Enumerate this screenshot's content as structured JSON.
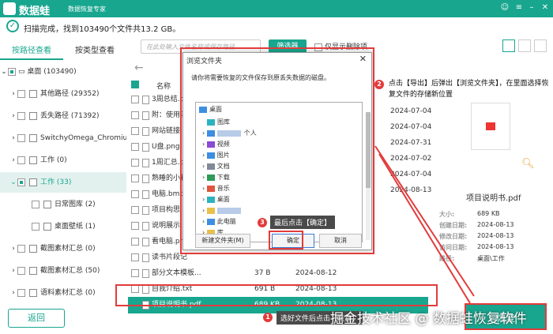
{
  "app": {
    "name": "数据蛙",
    "slogan": "数据恢复专家",
    "colors": {
      "accent": "#18a68f",
      "annotation": "#e23b3b"
    }
  },
  "status": {
    "text": "扫描完成，找到103490个文件共13.2 GB。"
  },
  "toolbar": {
    "search_placeholder": "在此处输入文件名称或保存路径",
    "filter_label": "筛选器",
    "only_deleted_label": "仅显示删除项"
  },
  "tabs": [
    {
      "label": "按路径查看"
    },
    {
      "label": "按类型查看"
    }
  ],
  "tree": [
    {
      "label": "桌面 (103490)"
    },
    {
      "label": "其他路径 (29352)"
    },
    {
      "label": "丢失路径 (71392)"
    },
    {
      "label": "SwitchyOmega_Chromium"
    },
    {
      "label": "工作 (0)"
    },
    {
      "label": "工作 (33)"
    },
    {
      "label": "日常图库 (2)"
    },
    {
      "label": "桌面壁纸 (1)"
    },
    {
      "label": "截图素材汇总 (0)"
    },
    {
      "label": "截图素材汇总 (50)"
    },
    {
      "label": "语料素材汇总 (0)"
    }
  ],
  "back_label": "返回",
  "list": {
    "header_name": "名称",
    "rows": [
      {
        "name": "3周总结.do",
        "size": "",
        "date": ""
      },
      {
        "name": "附：使用注",
        "size": "",
        "date": ""
      },
      {
        "name": "网站链接.t",
        "size": "",
        "date": ""
      },
      {
        "name": "U盘.png",
        "size": "",
        "date": ""
      },
      {
        "name": "1周汇总.do",
        "size": "",
        "date": ""
      },
      {
        "name": "熟睡的小猫",
        "size": "",
        "date": ""
      },
      {
        "name": "电脑.bmp",
        "size": "",
        "date": ""
      },
      {
        "name": "项目构思.",
        "size": "",
        "date": ""
      },
      {
        "name": "说明展示.p",
        "size": "",
        "date": ""
      },
      {
        "name": "看电脑.png",
        "size": "",
        "date": ""
      },
      {
        "name": "读书片段记",
        "size": "",
        "date": ""
      },
      {
        "name": "部分文本模板...",
        "size": "37 B",
        "date": "2024-08-12"
      },
      {
        "name": "自我介绍.txt",
        "size": "691 B",
        "date": "2024-08-13"
      },
      {
        "name": "项目说明书.pdf",
        "size": "689 KB",
        "date": "2024-08-13"
      }
    ],
    "right_dates": [
      "2024-07-04",
      "2024-07-04",
      "2024-07-31",
      "2024-07-02",
      "2024-07-04",
      "2024-08-13"
    ]
  },
  "preview": {
    "name": "项目说明书.pdf",
    "meta": [
      {
        "label": "大小:",
        "value": "689 KB"
      },
      {
        "label": "创建日期:",
        "value": "2024-08-13"
      },
      {
        "label": "修改日期:",
        "value": "2024-08-13"
      },
      {
        "label": "访问日期:",
        "value": "2024-08-13"
      },
      {
        "label": "路径:",
        "value": "桌面\\工作"
      }
    ]
  },
  "dialog": {
    "title": "浏览文件夹",
    "message": "请你将需要恢复的文件保存到原丢失数据的磁盘。",
    "nodes": [
      "桌面",
      "图库",
      "个人",
      "视频",
      "图片",
      "文档",
      "下载",
      "音乐",
      "桌面",
      "此电脑",
      "库"
    ],
    "new_folder": "新建文件夹(M)",
    "ok": "确定",
    "cancel": "取消"
  },
  "annotations": {
    "n1": "1",
    "n2": "2",
    "n3": "3",
    "a1": "选好文件后点击【恢复】",
    "a2": "点击【导出】后弹出【浏览文件夹】，在里面选择恢复文件的存储新位置",
    "a3": "最后点击【确定】"
  },
  "recover_label": "恢复",
  "watermark": "掘金技术社区 @ 数据蛙恢复软件"
}
